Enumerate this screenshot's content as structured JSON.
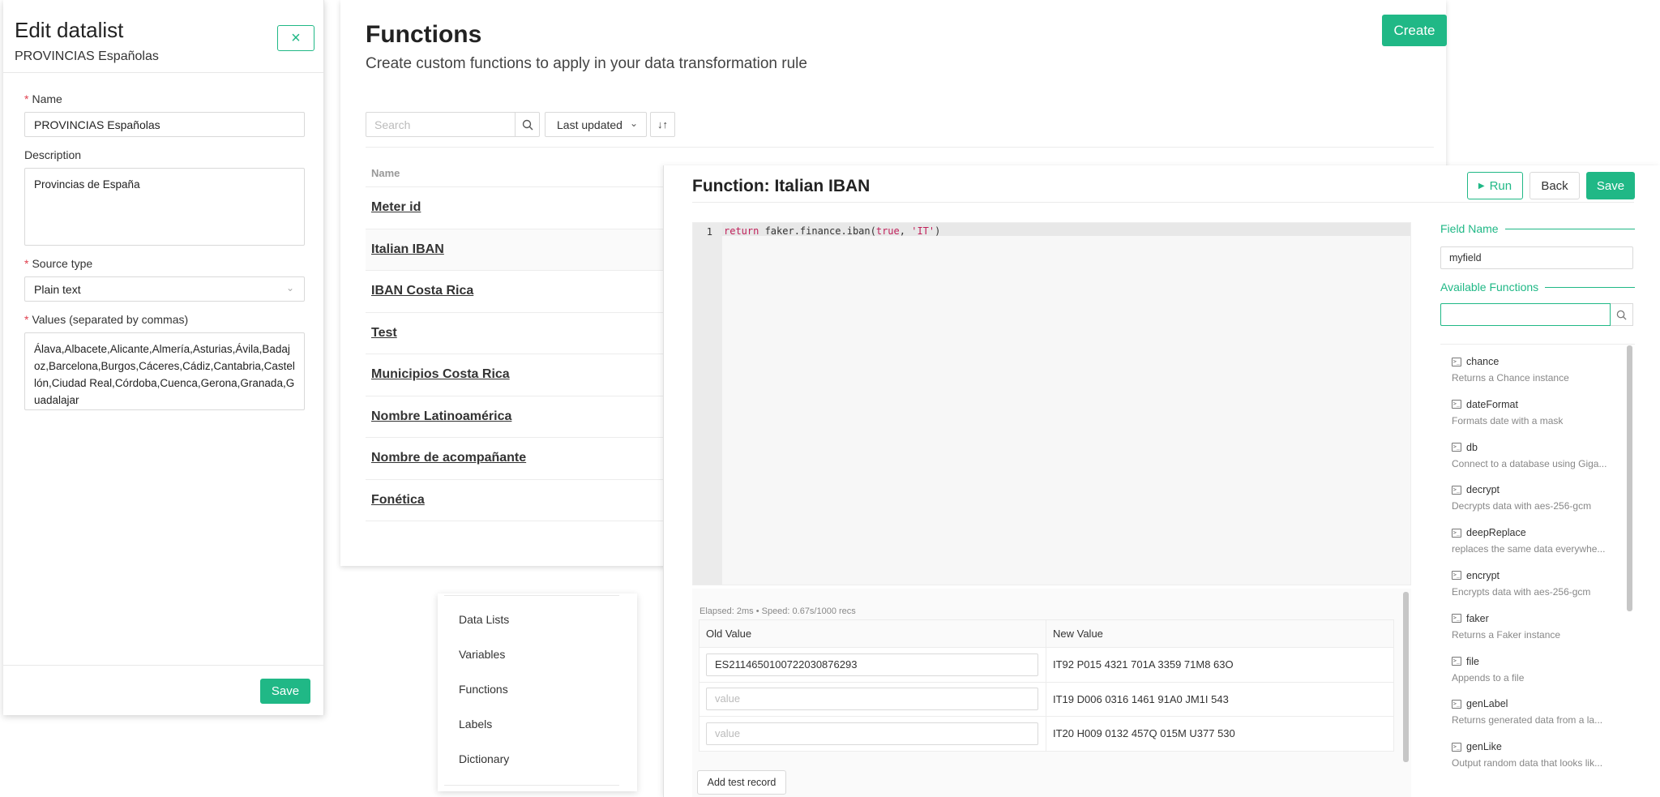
{
  "edit_panel": {
    "title": "Edit datalist",
    "subtitle": "PROVINCIAS Españolas",
    "close_icon": "×",
    "name_label": "Name",
    "name_value": "PROVINCIAS Españolas",
    "description_label": "Description",
    "description_value": "Provincias de España",
    "source_type_label": "Source type",
    "source_type_value": "Plain text",
    "values_label": "Values (separated by commas)",
    "values_value": "Álava,Albacete,Alicante,Almería,Asturias,Ávila,Badajoz,Barcelona,Burgos,Cáceres,Cádiz,Cantabria,Castellón,Ciudad Real,Córdoba,Cuenca,Gerona,Granada,Guadalajar",
    "save_label": "Save"
  },
  "functions_page": {
    "title": "Functions",
    "description": "Create custom functions to apply in your data transformation rule",
    "create_label": "Create",
    "search_placeholder": "Search",
    "sort_label": "Last updated",
    "column_name": "Name",
    "functions": [
      {
        "name": "Meter id"
      },
      {
        "name": "Italian IBAN"
      },
      {
        "name": "IBAN Costa Rica"
      },
      {
        "name": "Test"
      },
      {
        "name": "Municipios Costa Rica"
      },
      {
        "name": "Nombre Latinoamérica"
      },
      {
        "name": "Nombre de acompañante"
      },
      {
        "name": "Fonética"
      }
    ]
  },
  "side_menu": {
    "items": [
      "Data Lists",
      "Variables",
      "Functions",
      "Labels",
      "Dictionary"
    ]
  },
  "editor": {
    "title": "Function: Italian IBAN",
    "run_label": "Run",
    "back_label": "Back",
    "save_label": "Save",
    "code": {
      "line_number": "1",
      "kw": "return",
      "mid": " faker.finance.iban(",
      "lit1": "true",
      "sep": ", ",
      "lit2": "'IT'",
      "end": ")"
    },
    "elapsed": "Elapsed: 2ms  •  Speed: 0.67s/1000 recs",
    "col_old": "Old Value",
    "col_new": "New Value",
    "records": [
      {
        "old": "ES2114650100722030876293",
        "new": "IT92 P015 4321 701A 3359 71M8 63O"
      },
      {
        "old": "",
        "old_placeholder": "value",
        "new": "IT19 D006 0316 1461 91A0 JM1I 543"
      },
      {
        "old": "",
        "old_placeholder": "value",
        "new": "IT20 H009 0132 457Q 015M U377 530"
      }
    ],
    "add_record_label": "Add test record",
    "field_name_title": "Field Name",
    "field_name_value": "myfield",
    "available_functions_title": "Available Functions",
    "available_functions": [
      {
        "name": "chance",
        "desc": "Returns a Chance instance"
      },
      {
        "name": "dateFormat",
        "desc": "Formats date with a mask"
      },
      {
        "name": "db",
        "desc": "Connect to a database using Giga..."
      },
      {
        "name": "decrypt",
        "desc": "Decrypts data with aes-256-gcm"
      },
      {
        "name": "deepReplace",
        "desc": "replaces the same data everywhe..."
      },
      {
        "name": "encrypt",
        "desc": "Encrypts data with aes-256-gcm"
      },
      {
        "name": "faker",
        "desc": "Returns a Faker instance"
      },
      {
        "name": "file",
        "desc": "Appends to a file"
      },
      {
        "name": "genLabel",
        "desc": "Returns generated data from a la..."
      },
      {
        "name": "genLike",
        "desc": "Output random data that looks lik..."
      }
    ]
  }
}
